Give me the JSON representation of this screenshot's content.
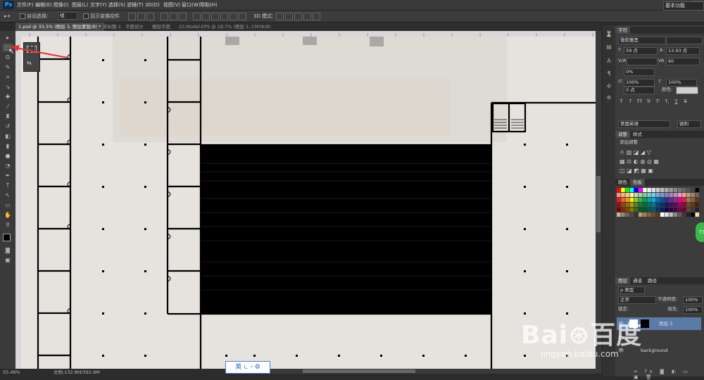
{
  "app": {
    "logo": "Ps"
  },
  "menus": [
    "文件(F)",
    "编辑(E)",
    "图像(I)",
    "图层(L)",
    "文字(Y)",
    "选择(S)",
    "滤镜(T)",
    "3D(D)",
    "视图(V)",
    "窗口(W)",
    "帮助(H)"
  ],
  "window_controls": {
    "minimize": "–",
    "maximize": "□",
    "close": "×"
  },
  "options_bar": {
    "auto_select_label": "自动选择：",
    "auto_select_value": "组",
    "show_transform_label": "显示变换控件",
    "mode_3d_label": "3D 模式：",
    "workspace": "基本功能"
  },
  "tabs": [
    "1.psd @ 33.3% (图层 3, 图层蒙版/8) *",
    "未标题-1",
    "平面设计",
    "楼层平面",
    "23.Model.EPS @ 18.7% (图层 1, CMYK/8)"
  ],
  "status": {
    "zoom": "55.49%",
    "doc": "文档:132.8M/392.8M"
  },
  "ime": {
    "text": "英 ⏾ ꞏ ⚙"
  },
  "character_panel": {
    "title": "字符",
    "font_family": "微软雅黑",
    "font_style": "",
    "font_size": "59 点",
    "leading": "13.93 点",
    "tracking_label": "VA",
    "tracking": "60",
    "scale_label": "0%",
    "vscale": "100%",
    "hscale": "100%",
    "baseline": "0 点",
    "color_label": "颜色:",
    "language": "美国英语",
    "antialias": "锐利",
    "style_buttons": [
      "T",
      "T",
      "TT",
      "Tr",
      "T'",
      "T,",
      "T",
      "T"
    ]
  },
  "adjust_panel": {
    "tab1": "调整",
    "tab2": "样式",
    "add_label": "添加调整"
  },
  "swatch_panel": {
    "tab1": "颜色",
    "tab2": "色板"
  },
  "layers_panel": {
    "tabs": [
      "图层",
      "通道",
      "路径"
    ],
    "filter_label": "ρ 类型",
    "blend_mode": "正常",
    "opacity_label": "不透明度:",
    "opacity": "100%",
    "lock_label": "锁定:",
    "fill_label": "填充:",
    "fill": "100%",
    "layers": [
      {
        "name": "图层 3",
        "selected": true
      },
      {
        "name": "",
        "selected": false
      },
      {
        "name": "background",
        "selected": false
      }
    ]
  },
  "colors": {
    "accent_blue": "#39a7f5",
    "canvas_bg": "#e6e3df",
    "arrow": "#e8342c",
    "green": "#3cb84a"
  },
  "watermark": {
    "text": "Bai⊛百度",
    "url": "jingyan.baidu.com"
  },
  "green_badge": "73"
}
